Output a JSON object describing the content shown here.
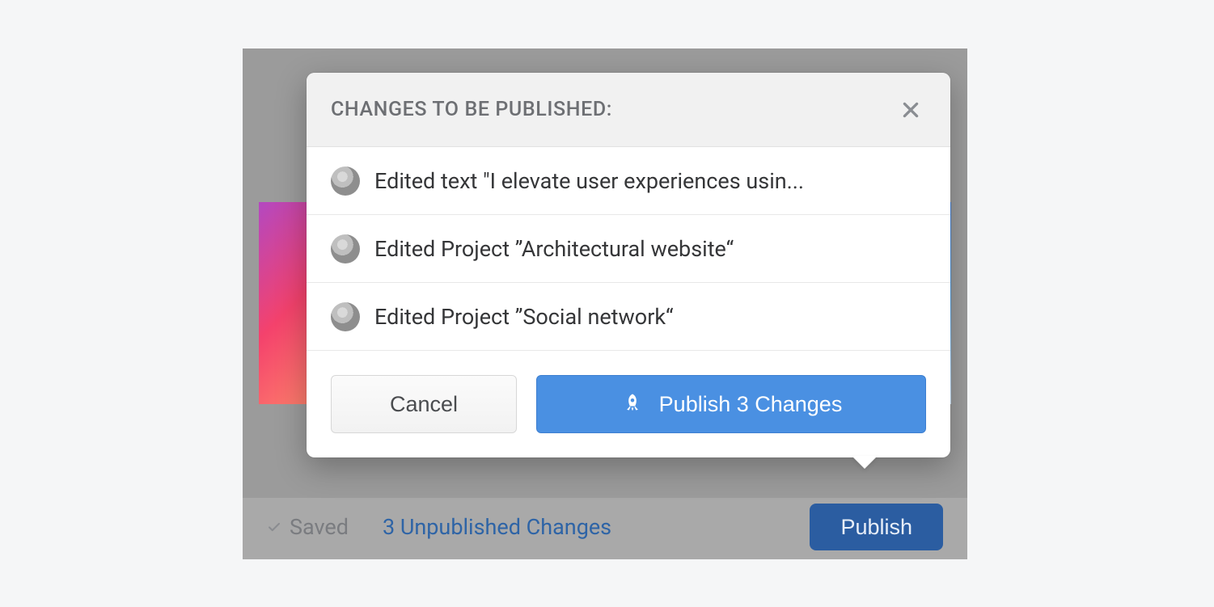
{
  "popover": {
    "title": "CHANGES TO BE PUBLISHED:",
    "changes": [
      {
        "label": "Edited text \"I elevate user experiences usin..."
      },
      {
        "label": "Edited Project ”Architectural website“"
      },
      {
        "label": "Edited Project ”Social network“"
      }
    ],
    "cancel_label": "Cancel",
    "publish_label": "Publish 3 Changes"
  },
  "statusbar": {
    "saved_label": "Saved",
    "changes_label": "3 Unpublished Changes",
    "publish_label": "Publish"
  },
  "colors": {
    "primary": "#4a90e2",
    "primary_dark": "#2b5da1",
    "link": "#2e64a6"
  }
}
